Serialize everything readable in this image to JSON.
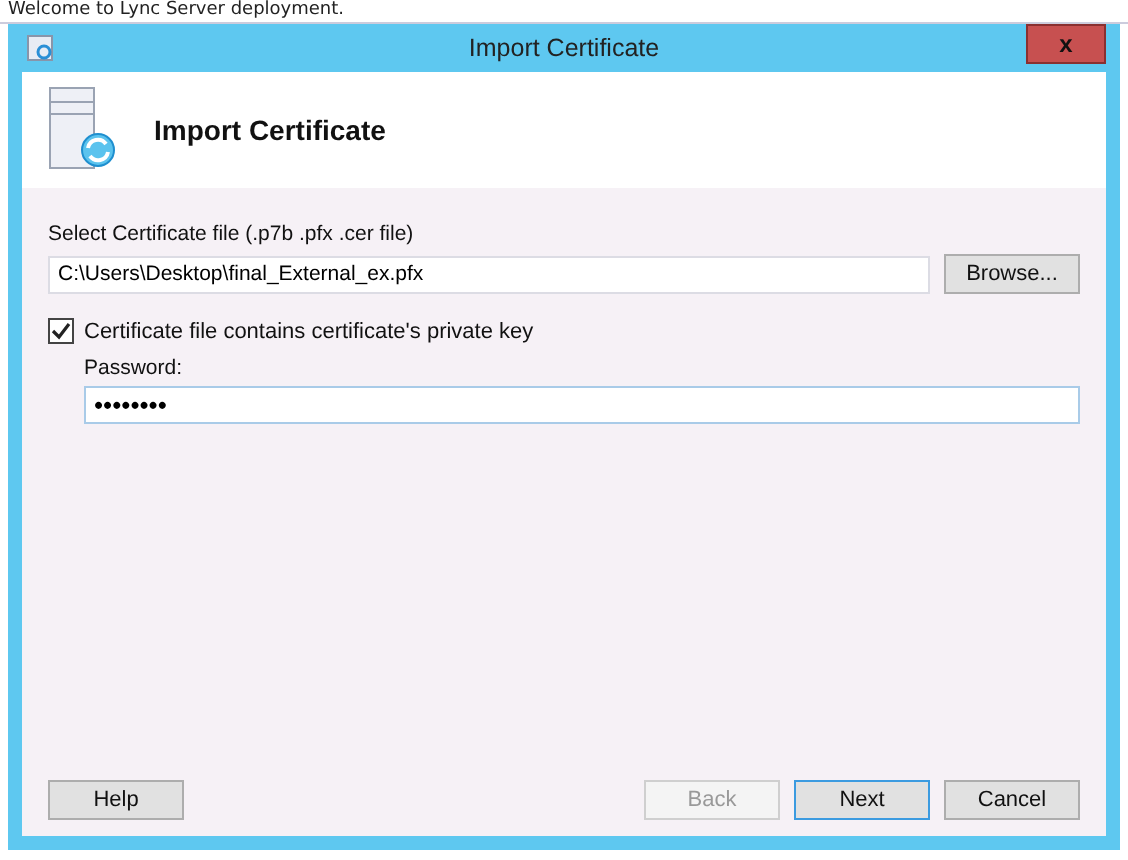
{
  "background": {
    "text": "Welcome to Lync Server deployment."
  },
  "window": {
    "title": "Import Certificate",
    "close": "x"
  },
  "header": {
    "title": "Import Certificate"
  },
  "file": {
    "label": "Select Certificate file (.p7b .pfx .cer file)",
    "value": "C:\\Users\\Desktop\\final_External_ex.pfx",
    "button": "Browse..."
  },
  "private_key": {
    "label": "Certificate file contains certificate's private key",
    "checked": true
  },
  "password": {
    "label": "Password:",
    "value": "••••••••"
  },
  "buttons": [
    {
      "label": "Help",
      "disabled": false,
      "focused": false
    },
    {
      "label": "Back",
      "disabled": true,
      "focused": false
    },
    {
      "label": "Next",
      "disabled": false,
      "focused": true
    },
    {
      "label": "Cancel",
      "disabled": false,
      "focused": false
    }
  ]
}
